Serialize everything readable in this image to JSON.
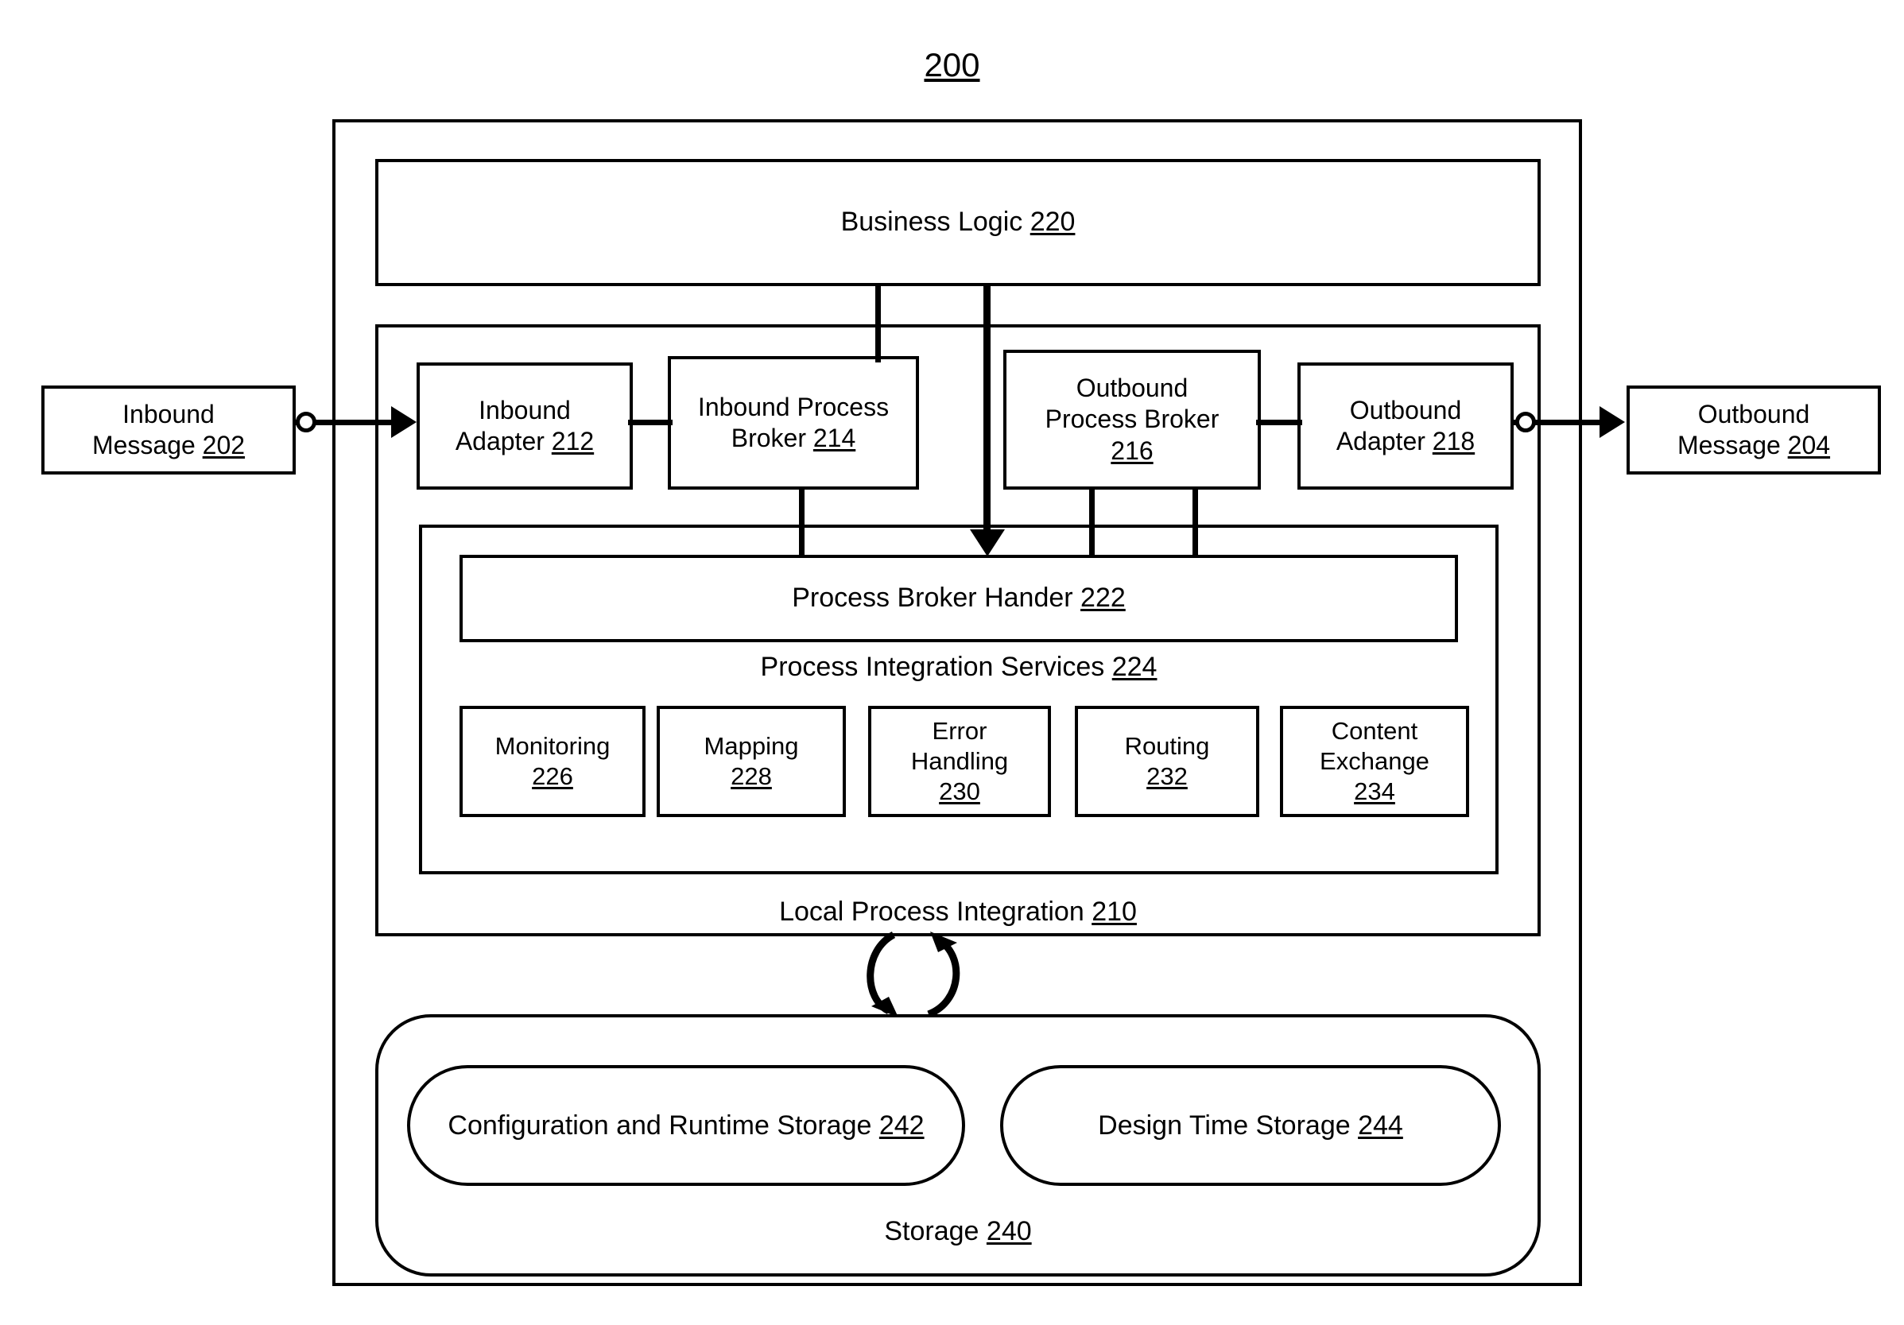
{
  "figure": {
    "number": "200"
  },
  "business_logic": {
    "name": "Business Logic",
    "ref": "220"
  },
  "messages": {
    "inbound": {
      "line1": "Inbound",
      "line2": "Message",
      "ref": "202"
    },
    "outbound": {
      "line1": "Outbound",
      "line2": "Message",
      "ref": "204"
    }
  },
  "adapters": {
    "inbound_adapter": {
      "line1": "Inbound",
      "line2": "Adapter",
      "ref": "212"
    },
    "inbound_broker": {
      "line1": "Inbound Process",
      "line2": "Broker",
      "ref": "214"
    },
    "outbound_broker": {
      "line1": "Outbound",
      "line2": "Process Broker",
      "ref": "216"
    },
    "outbound_adapter": {
      "line1": "Outbound",
      "line2": "Adapter",
      "ref": "218"
    }
  },
  "local_process_integration": {
    "name": "Local Process Integration",
    "ref": "210"
  },
  "process_broker_handler": {
    "name": "Process Broker Hander",
    "ref": "222"
  },
  "process_integration_services": {
    "name": "Process Integration Services",
    "ref": "224",
    "services": [
      {
        "line1": "Monitoring",
        "line2": "",
        "ref": "226"
      },
      {
        "line1": "Mapping",
        "line2": "",
        "ref": "228"
      },
      {
        "line1": "Error",
        "line2": "Handling",
        "ref": "230"
      },
      {
        "line1": "Routing",
        "line2": "",
        "ref": "232"
      },
      {
        "line1": "Content",
        "line2": "Exchange",
        "ref": "234"
      }
    ]
  },
  "storage": {
    "name": "Storage",
    "ref": "240",
    "config_runtime": {
      "name": "Configuration and Runtime Storage",
      "ref": "242"
    },
    "design_time": {
      "name": "Design Time Storage",
      "ref": "244"
    }
  },
  "icons": {
    "port_in": "connector-port-circle",
    "port_out": "connector-port-circle",
    "cycle": "bidirectional-cycle-arrow"
  },
  "colors": {
    "stroke": "#000000",
    "background": "#ffffff"
  }
}
